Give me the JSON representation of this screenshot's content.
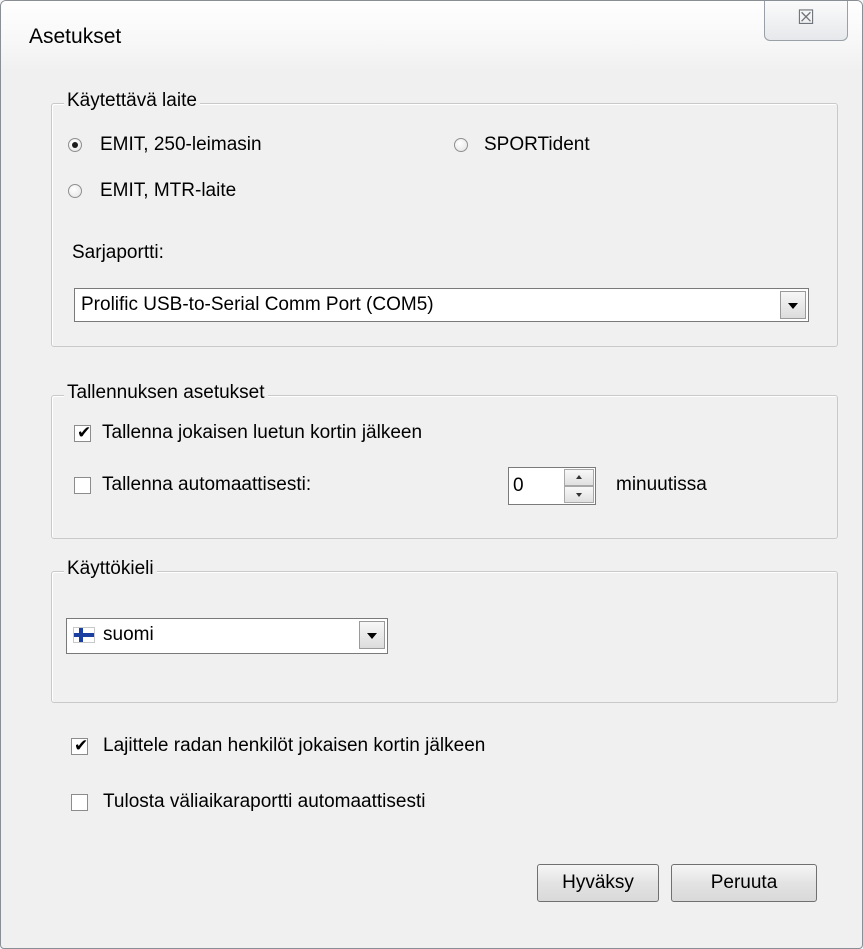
{
  "window": {
    "title": "Asetukset",
    "close_glyph": "☒"
  },
  "device_group": {
    "legend": "Käytettävä laite",
    "options": [
      {
        "label": "EMIT, 250-leimasin",
        "selected": true
      },
      {
        "label": "SPORTident",
        "selected": false
      },
      {
        "label": "EMIT, MTR-laite",
        "selected": false
      }
    ],
    "serial_port_label": "Sarjaportti:",
    "serial_port_value": "Prolific USB-to-Serial Comm Port (COM5)"
  },
  "save_group": {
    "legend": "Tallennuksen asetukset",
    "save_after_each_card": {
      "label": "Tallenna jokaisen luetun kortin jälkeen",
      "checked": true
    },
    "save_automatically": {
      "label": "Tallenna automaattisesti:",
      "checked": false
    },
    "interval_value": "0",
    "interval_unit": "minuutissa"
  },
  "language_group": {
    "legend": "Käyttökieli",
    "selected_language": "suomi",
    "flag_icon": "finland-flag-icon"
  },
  "options": {
    "sort_persons": {
      "label": "Lajittele radan henkilöt jokaisen kortin jälkeen",
      "checked": true
    },
    "print_split_report": {
      "label": "Tulosta väliaikaraportti automaattisesti",
      "checked": false
    }
  },
  "buttons": {
    "ok": "Hyväksy",
    "cancel": "Peruuta"
  }
}
